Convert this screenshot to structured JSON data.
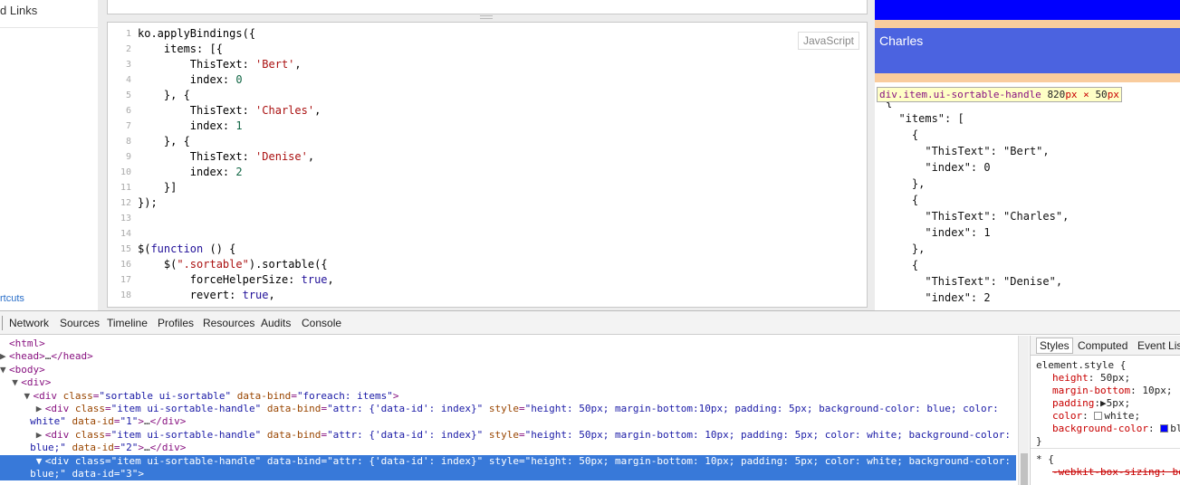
{
  "sidebar": {
    "links_label": "d Links",
    "shortcuts_label": "rtcuts"
  },
  "js_panel": {
    "language_label": "JavaScript",
    "line_numbers": [
      "1",
      "2",
      "3",
      "4",
      "5",
      "6",
      "7",
      "8",
      "9",
      "10",
      "11",
      "12",
      "13",
      "14",
      "15",
      "16",
      "17",
      "18"
    ]
  },
  "result": {
    "item_label": "Charles",
    "tooltip": {
      "selector": "div.item.ui-sortable-handle",
      "width": "820",
      "height": "50",
      "unit": "px",
      "times": " × "
    },
    "json_lines": [
      "{",
      "  \"items\": [",
      "    {",
      "      \"ThisText\": \"Bert\",",
      "      \"index\": 0",
      "    },",
      "    {",
      "      \"ThisText\": \"Charles\",",
      "      \"index\": 1",
      "    },",
      "    {",
      "      \"ThisText\": \"Denise\",",
      "      \"index\": 2"
    ]
  },
  "devtools": {
    "tabs": [
      "Network",
      "Sources",
      "Timeline",
      "Profiles",
      "Resources",
      "Audits",
      "Console"
    ],
    "styles_tabs": [
      "Styles",
      "Computed",
      "Event Lis"
    ],
    "element_style_selector": "element.style {",
    "style_props": [
      {
        "name": "height",
        "value": "50px;"
      },
      {
        "name": "margin-bottom",
        "value": "10px;"
      },
      {
        "name": "padding",
        "value": "5px;"
      },
      {
        "name": "color",
        "value": "white;"
      },
      {
        "name": "background-color",
        "value": "bl"
      }
    ],
    "close_brace": "}",
    "universal_selector": "* {",
    "struck_prop": "-webkit-box-sizing: bo"
  },
  "colors": {
    "accent_blue": "#0000ff",
    "item_blue": "#4b63e0",
    "selection_blue": "#3879d9",
    "margin_orange": "#f9cc9d"
  }
}
